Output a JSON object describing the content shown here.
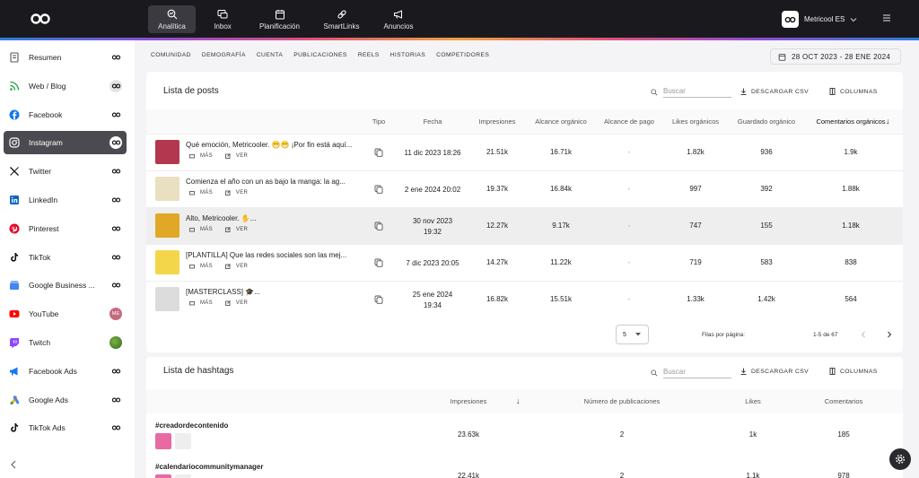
{
  "topnav": {
    "items": [
      {
        "label": "Analítica",
        "icon": "analytics-icon",
        "active": true
      },
      {
        "label": "Inbox",
        "icon": "inbox-icon"
      },
      {
        "label": "Planificación",
        "icon": "calendar-icon"
      },
      {
        "label": "SmartLinks",
        "icon": "link-icon"
      },
      {
        "label": "Anuncios",
        "icon": "megaphone-icon"
      }
    ],
    "brand_name": "Metricool ES"
  },
  "sidebar": {
    "items": [
      {
        "label": "Resumen",
        "icon": "summary-icon",
        "color": "#555555"
      },
      {
        "label": "Web / Blog",
        "icon": "rss-icon",
        "color": "#1e9e4a"
      },
      {
        "label": "Facebook",
        "icon": "facebook-icon",
        "color": "#1877f2"
      },
      {
        "label": "Instagram",
        "icon": "instagram-icon",
        "color": "#ffffff",
        "active": true
      },
      {
        "label": "Twitter",
        "icon": "x-icon",
        "color": "#111111"
      },
      {
        "label": "LinkedIn",
        "icon": "linkedin-icon",
        "color": "#0a66c2"
      },
      {
        "label": "Pinterest",
        "icon": "pinterest-icon",
        "color": "#e60023"
      },
      {
        "label": "TikTok",
        "icon": "tiktok-icon",
        "color": "#111111"
      },
      {
        "label": "Google Business ...",
        "icon": "google-business-icon",
        "color": "#4285f4"
      },
      {
        "label": "YouTube",
        "icon": "youtube-icon",
        "color": "#ff0000",
        "badge": "ME"
      },
      {
        "label": "Twitch",
        "icon": "twitch-icon",
        "color": "#9146ff"
      },
      {
        "label": "Facebook Ads",
        "icon": "facebook-ads-icon",
        "color": "#1877f2"
      },
      {
        "label": "Google Ads",
        "icon": "google-ads-icon",
        "color": "#34a853"
      },
      {
        "label": "TikTok Ads",
        "icon": "tiktok-ads-icon",
        "color": "#111111"
      }
    ]
  },
  "subnav": {
    "tabs": [
      "COMUNIDAD",
      "DEMOGRAFÍA",
      "CUENTA",
      "PUBLICACIONES",
      "REELS",
      "HISTORIAS",
      "COMPETIDORES"
    ],
    "date_range": "28 OCT 2023 - 28 ENE 2024"
  },
  "posts": {
    "title": "Lista de posts",
    "search_placeholder": "Buscar",
    "download_label": "DESCARGAR CSV",
    "columns_label": "COLUMNAS",
    "headers": [
      "Tipo",
      "Fecha",
      "Impresiones",
      "Alcance orgánico",
      "Alcance de pago",
      "Likes orgánicos",
      "Guardado orgánico",
      "Comentarios orgánicos"
    ],
    "more_label": "MÁS",
    "view_label": "VER",
    "rows": [
      {
        "text": "Qué emoción, Metricooler. 😁😁 ¡Por fin está aquí...",
        "date1": "11 dic 2023 18:26",
        "date2": "",
        "impressions": "21.51k",
        "reach": "16.71k",
        "paid": "-",
        "likes": "1.82k",
        "saved": "936",
        "comments": "1.9k",
        "thumb": "#b3374f"
      },
      {
        "text": "Comienza el año con un as bajo la manga: la ag...",
        "date1": "2 ene 2024 20:02",
        "date2": "",
        "impressions": "19.37k",
        "reach": "16.84k",
        "paid": "-",
        "likes": "997",
        "saved": "392",
        "comments": "1.88k",
        "thumb": "#e8e0c0"
      },
      {
        "text": "Alto, Metricooler. ✋...",
        "date1": "30 nov 2023",
        "date2": "19:32",
        "impressions": "12.27k",
        "reach": "9.17k",
        "paid": "-",
        "likes": "747",
        "saved": "155",
        "comments": "1.18k",
        "thumb": "#e0a826"
      },
      {
        "text": "[PLANTILLA] Que las redes sociales son las mej...",
        "date1": "7 dic 2023 20:05",
        "date2": "",
        "impressions": "14.27k",
        "reach": "11.22k",
        "paid": "-",
        "likes": "719",
        "saved": "583",
        "comments": "838",
        "thumb": "#f3d64a"
      },
      {
        "text": "[MASTERCLASS] 🎓...",
        "date1": "25 ene 2024",
        "date2": "19:34",
        "impressions": "16.82k",
        "reach": "15.51k",
        "paid": "-",
        "likes": "1.33k",
        "saved": "1.42k",
        "comments": "564",
        "thumb": "#dcdcdc"
      }
    ],
    "rows_per_page_label": "Filas por página:",
    "rows_per_page": "5",
    "range": "1-5 de 67"
  },
  "hashtags": {
    "title": "Lista de hashtags",
    "search_placeholder": "Buscar",
    "download_label": "DESCARGAR CSV",
    "columns_label": "COLUMNAS",
    "headers": [
      "Impresiones",
      "Número de publicaciones",
      "Likes",
      "Comentarios"
    ],
    "rows": [
      {
        "tag": "#creadordecontenido",
        "impressions": "23.63k",
        "posts": "2",
        "likes": "1k",
        "comments": "185"
      },
      {
        "tag": "#calendariocommunitymanager",
        "impressions": "22.41k",
        "posts": "2",
        "likes": "1.1k",
        "comments": "978"
      }
    ]
  }
}
